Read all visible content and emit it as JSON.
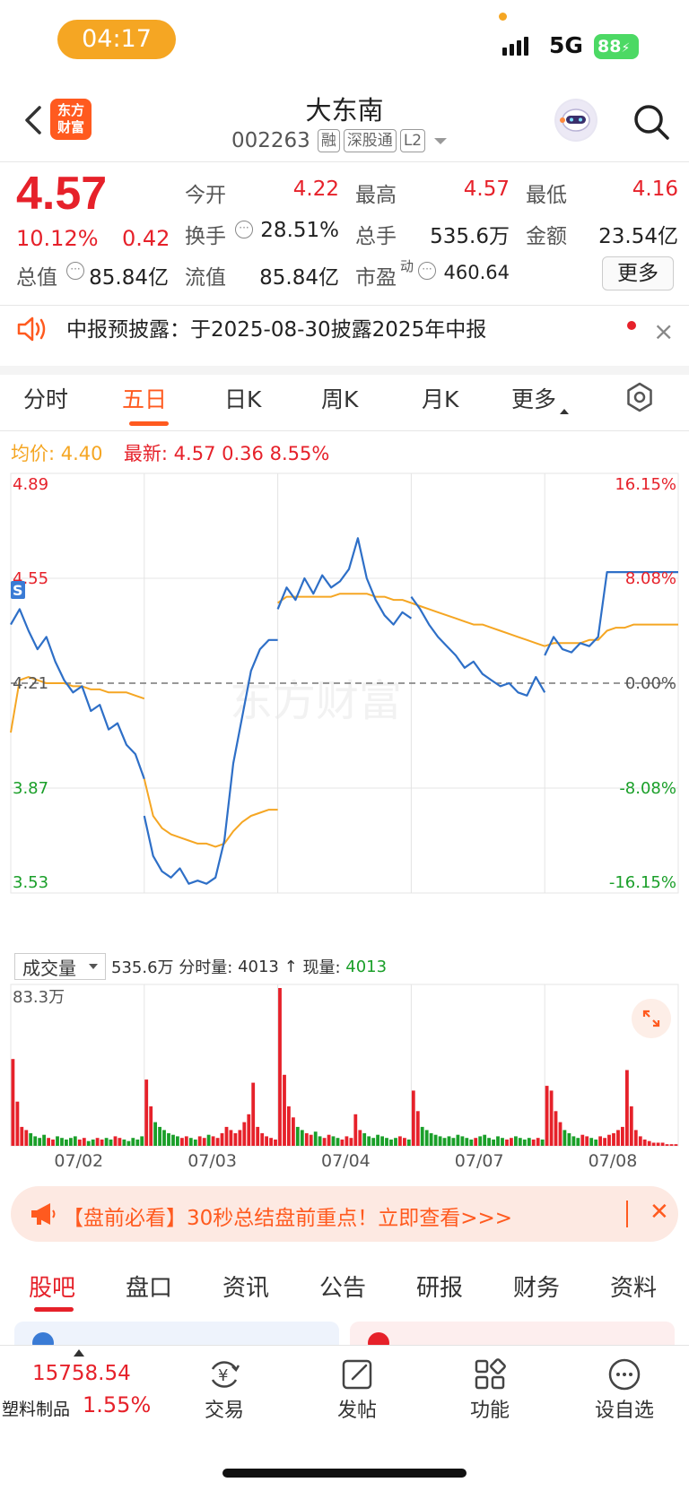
{
  "status_bar": {
    "time": "04:17",
    "network": "5G",
    "battery": "88"
  },
  "header": {
    "stock_name": "大东南",
    "stock_code": "002263",
    "tags": [
      "融",
      "深股通",
      "L2"
    ],
    "brand_logo_text": "东方财富"
  },
  "quote": {
    "price": "4.57",
    "change_pct": "10.12%",
    "change": "0.42",
    "fields": [
      {
        "label": "今开",
        "value": "4.22",
        "color": "red"
      },
      {
        "label": "最高",
        "value": "4.57",
        "color": "red"
      },
      {
        "label": "最低",
        "value": "4.16",
        "color": "red"
      },
      {
        "label": "换手",
        "value": "28.51%",
        "color": "dark"
      },
      {
        "label": "总手",
        "value": "535.6万",
        "color": "dark"
      },
      {
        "label": "金额",
        "value": "23.54亿",
        "color": "dark"
      },
      {
        "label": "总值",
        "value": "85.84亿",
        "color": "dark"
      },
      {
        "label": "流值",
        "value": "85.84亿",
        "color": "dark"
      },
      {
        "label": "市盈",
        "value": "460.64",
        "color": "dark",
        "sup": "动"
      }
    ],
    "more_label": "更多"
  },
  "notice": {
    "text": "中报预披露：于2025-08-30披露2025年中报"
  },
  "tabs": {
    "items": [
      "分时",
      "五日",
      "日K",
      "周K",
      "月K",
      "更多"
    ],
    "active": "五日"
  },
  "legend": {
    "avg_label": "均价:",
    "avg_value": "4.40",
    "latest_label": "最新:",
    "latest_value": "4.57",
    "latest_change": "0.36",
    "latest_pct": "8.55%"
  },
  "chart_data": {
    "type": "line",
    "title": "",
    "x": [
      "07/02",
      "07/03",
      "07/04",
      "07/07",
      "07/08"
    ],
    "price_ticks": [
      "4.89",
      "4.55",
      "4.21",
      "3.87",
      "3.53"
    ],
    "pct_ticks": [
      "16.15%",
      "8.08%",
      "0.00%",
      "-8.08%",
      "-16.15%"
    ],
    "ylim": [
      3.53,
      4.89
    ],
    "prev_close": 4.21,
    "grid": true,
    "series": [
      {
        "name": "",
        "color": "#2e6fc7",
        "values": [
          [
            4.4,
            4.45,
            4.38,
            4.32,
            4.36,
            4.28,
            4.22,
            4.18,
            4.2,
            4.12,
            4.14,
            4.06,
            4.08,
            4.01,
            3.98,
            3.9
          ],
          [
            3.78,
            3.65,
            3.6,
            3.58,
            3.61,
            3.56,
            3.57,
            3.56,
            3.58,
            3.7,
            3.95,
            4.1,
            4.25,
            4.32,
            4.35,
            4.35
          ],
          [
            4.45,
            4.52,
            4.48,
            4.55,
            4.5,
            4.56,
            4.52,
            4.54,
            4.58,
            4.68,
            4.55,
            4.48,
            4.43,
            4.4,
            4.44,
            4.42
          ],
          [
            4.49,
            4.45,
            4.4,
            4.36,
            4.33,
            4.3,
            4.26,
            4.28,
            4.24,
            4.22,
            4.2,
            4.21,
            4.18,
            4.17,
            4.23,
            4.18
          ],
          [
            4.3,
            4.36,
            4.32,
            4.31,
            4.34,
            4.33,
            4.36,
            4.57,
            4.57,
            4.57,
            4.57,
            4.57,
            4.57,
            4.57,
            4.57,
            4.57
          ]
        ]
      },
      {
        "name": "",
        "color": "#f5a623",
        "values": [
          [
            4.05,
            4.22,
            4.23,
            4.22,
            4.21,
            4.21,
            4.21,
            4.2,
            4.2,
            4.19,
            4.19,
            4.18,
            4.18,
            4.18,
            4.17,
            4.16
          ],
          [
            3.9,
            3.78,
            3.74,
            3.72,
            3.71,
            3.7,
            3.69,
            3.69,
            3.68,
            3.69,
            3.73,
            3.76,
            3.78,
            3.79,
            3.8,
            3.8
          ],
          [
            4.47,
            4.49,
            4.49,
            4.49,
            4.49,
            4.49,
            4.49,
            4.5,
            4.5,
            4.5,
            4.5,
            4.49,
            4.49,
            4.48,
            4.48,
            4.47
          ],
          [
            4.47,
            4.46,
            4.45,
            4.44,
            4.43,
            4.42,
            4.41,
            4.4,
            4.4,
            4.39,
            4.38,
            4.37,
            4.36,
            4.35,
            4.34,
            4.33
          ],
          [
            4.33,
            4.34,
            4.34,
            4.34,
            4.34,
            4.35,
            4.35,
            4.38,
            4.39,
            4.39,
            4.4,
            4.4,
            4.4,
            4.4,
            4.4,
            4.4
          ]
        ]
      }
    ]
  },
  "volume": {
    "selector_label": "成交量",
    "total_label": "535.6万",
    "tick_vol_label": "分时量:",
    "tick_vol_value": "4013",
    "current_label": "现量:",
    "current_value": "4013",
    "arrow": "↑",
    "max_label": "83.3万",
    "max_value": 833000,
    "bars": [
      [
        0.55,
        0.28,
        0.12,
        0.1,
        0.08,
        0.06,
        0.05,
        0.07,
        0.05,
        0.04,
        0.06,
        0.05,
        0.04,
        0.05,
        0.06,
        0.04,
        0.05,
        0.03,
        0.04,
        0.05,
        0.04,
        0.05,
        0.04,
        0.06,
        0.05,
        0.04,
        0.03,
        0.05,
        0.04,
        0.06
      ],
      [
        0.42,
        0.25,
        0.15,
        0.12,
        0.1,
        0.08,
        0.07,
        0.06,
        0.05,
        0.06,
        0.05,
        0.04,
        0.06,
        0.05,
        0.07,
        0.06,
        0.05,
        0.08,
        0.12,
        0.1,
        0.08,
        0.1,
        0.15,
        0.2,
        0.4,
        0.12,
        0.08,
        0.06,
        0.05,
        0.04
      ],
      [
        1.0,
        0.45,
        0.25,
        0.18,
        0.12,
        0.1,
        0.08,
        0.07,
        0.09,
        0.06,
        0.05,
        0.07,
        0.06,
        0.05,
        0.04,
        0.06,
        0.05,
        0.2,
        0.1,
        0.08,
        0.06,
        0.05,
        0.07,
        0.06,
        0.05,
        0.04,
        0.05,
        0.06,
        0.05,
        0.04
      ],
      [
        0.35,
        0.22,
        0.12,
        0.1,
        0.08,
        0.07,
        0.06,
        0.05,
        0.06,
        0.05,
        0.07,
        0.06,
        0.05,
        0.04,
        0.05,
        0.06,
        0.07,
        0.05,
        0.04,
        0.06,
        0.05,
        0.04,
        0.05,
        0.06,
        0.05,
        0.04,
        0.05,
        0.04,
        0.05,
        0.04
      ],
      [
        0.38,
        0.35,
        0.22,
        0.15,
        0.1,
        0.08,
        0.06,
        0.05,
        0.07,
        0.06,
        0.05,
        0.04,
        0.06,
        0.05,
        0.07,
        0.08,
        0.1,
        0.12,
        0.48,
        0.25,
        0.1,
        0.06,
        0.04,
        0.03,
        0.02,
        0.02,
        0.02,
        0.01,
        0.01,
        0.01
      ]
    ]
  },
  "banner": {
    "text": "【盘前必看】30秒总结盘前重点！立即查看>>>"
  },
  "content_tabs": {
    "items": [
      "股吧",
      "盘口",
      "资讯",
      "公告",
      "研报",
      "财务",
      "资料"
    ],
    "active": "股吧"
  },
  "footer": {
    "index_value": "15758.54",
    "index_name": "塑料制品",
    "index_pct": "1.55%",
    "buttons": [
      "交易",
      "发帖",
      "功能",
      "设自选"
    ]
  },
  "colors": {
    "up": "#e6212a",
    "down": "#1a9f29",
    "accent": "#ff5a1f",
    "price_line": "#2e6fc7",
    "avg_line": "#f5a623"
  }
}
